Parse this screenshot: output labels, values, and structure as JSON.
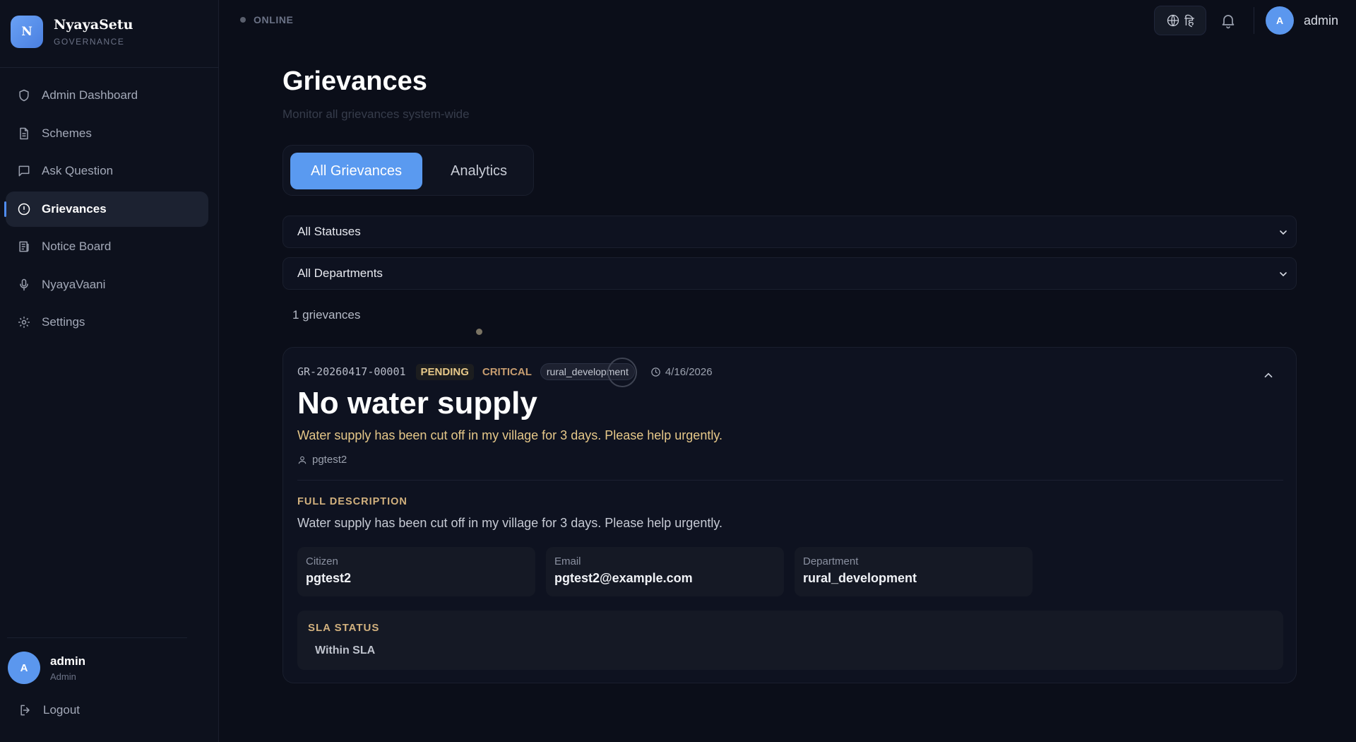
{
  "brand": {
    "logo_letter": "N",
    "name": "NyayaSetu",
    "subtitle": "GOVERNANCE"
  },
  "sidebar": {
    "items": [
      {
        "label": "Admin Dashboard",
        "icon": "shield-icon"
      },
      {
        "label": "Schemes",
        "icon": "document-icon"
      },
      {
        "label": "Ask Question",
        "icon": "chat-icon"
      },
      {
        "label": "Grievances",
        "icon": "alert-circle-icon",
        "active": true
      },
      {
        "label": "Notice Board",
        "icon": "notice-board-icon"
      },
      {
        "label": "NyayaVaani",
        "icon": "microphone-icon"
      },
      {
        "label": "Settings",
        "icon": "gear-icon"
      }
    ],
    "user": {
      "initial": "A",
      "name": "admin",
      "role": "Admin"
    },
    "logout_label": "Logout"
  },
  "topbar": {
    "status": "ONLINE",
    "language_glyph": "हि",
    "user": {
      "initial": "A",
      "name": "admin"
    }
  },
  "page": {
    "title": "Grievances",
    "subtitle": "Monitor all grievances system-wide",
    "tabs": [
      {
        "label": "All Grievances",
        "active": true
      },
      {
        "label": "Analytics",
        "active": false
      }
    ],
    "filters": {
      "status": "All Statuses",
      "department": "All Departments"
    },
    "count_text": "1 grievances"
  },
  "grievance": {
    "id": "GR-20260417-00001",
    "status": "PENDING",
    "priority": "CRITICAL",
    "department_tag": "rural_development",
    "date": "4/16/2026",
    "title": "No water supply",
    "summary": "Water supply has been cut off in my village for 3 days. Please help urgently.",
    "submitted_by": "pgtest2",
    "full_description_label": "FULL DESCRIPTION",
    "full_description": "Water supply has been cut off in my village for 3 days. Please help urgently.",
    "details": {
      "citizen_label": "Citizen",
      "citizen": "pgtest2",
      "email_label": "Email",
      "email": "pgtest2@example.com",
      "department_label": "Department",
      "department": "rural_development"
    },
    "sla_label": "SLA STATUS",
    "sla_value": "Within SLA"
  },
  "colors": {
    "accent": "#5a9af0",
    "background": "#0b0e19",
    "gold": "#e6c889"
  }
}
